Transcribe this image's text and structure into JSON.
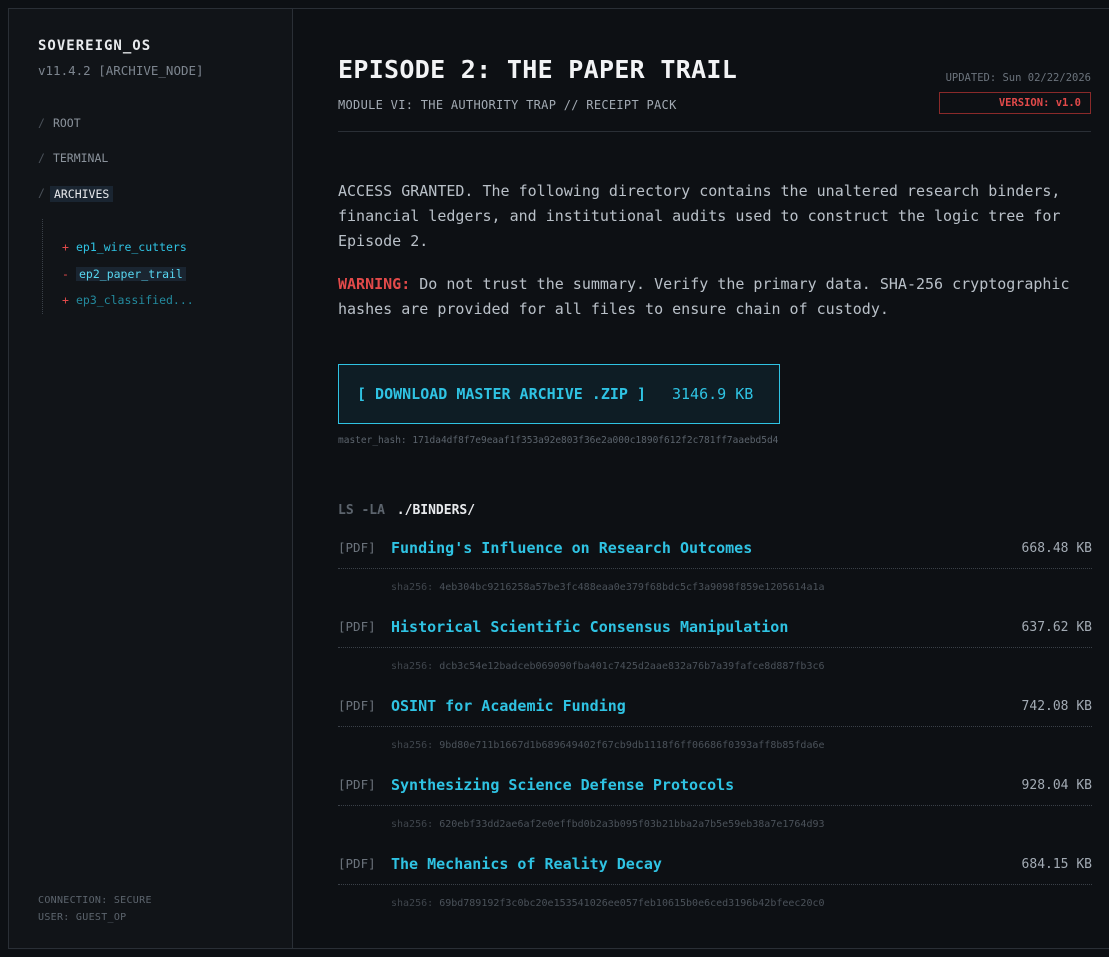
{
  "sidebar": {
    "brand": "SOVEREIGN_OS",
    "version": "v11.4.2 [ARCHIVE_NODE]",
    "nav": [
      {
        "slash": "/",
        "label": "ROOT"
      },
      {
        "slash": "/",
        "label": "TERMINAL"
      },
      {
        "slash": "/",
        "label": "ARCHIVES"
      }
    ],
    "episodes": [
      {
        "mark": "+",
        "label": "ep1_wire_cutters"
      },
      {
        "mark": "-",
        "label": "ep2_paper_trail"
      },
      {
        "mark": "+",
        "label": "ep3_classified..."
      }
    ],
    "status": {
      "connection": "CONNECTION: SECURE",
      "user": "USER: GUEST_OP"
    }
  },
  "header": {
    "title": "EPISODE 2: THE PAPER TRAIL",
    "subtitle": "MODULE VI: THE AUTHORITY TRAP // RECEIPT PACK",
    "updated": "UPDATED: Sun 02/22/2026",
    "version": "VERSION: v1.0"
  },
  "intro": "ACCESS GRANTED. The following directory contains the unaltered research binders, financial ledgers, and institutional audits used to construct the logic tree for Episode 2.",
  "warning": {
    "label": "WARNING:",
    "text": " Do not trust the summary. Verify the primary data. SHA-256 cryptographic hashes are provided for all files to ensure chain of custody."
  },
  "download": {
    "label": "[ DOWNLOAD MASTER ARCHIVE .ZIP ]",
    "size": "3146.9 KB",
    "hash": "master_hash: 171da4df8f7e9eaaf1f353a92e803f36e2a000c1890f612f2c781ff7aaebd5d4"
  },
  "listing": {
    "cmd": "LS -LA",
    "path": "./BINDERS/"
  },
  "files": [
    {
      "tag": "[PDF]",
      "name": "Funding's Influence on Research Outcomes",
      "size": "668.48 KB",
      "hash_key": "sha256:",
      "hash": "4eb304bc9216258a57be3fc488eaa0e379f68bdc5cf3a9098f859e1205614a1a"
    },
    {
      "tag": "[PDF]",
      "name": "Historical Scientific Consensus Manipulation",
      "size": "637.62 KB",
      "hash_key": "sha256:",
      "hash": "dcb3c54e12badceb069090fba401c7425d2aae832a76b7a39fafce8d887fb3c6"
    },
    {
      "tag": "[PDF]",
      "name": "OSINT for Academic Funding",
      "size": "742.08 KB",
      "hash_key": "sha256:",
      "hash": "9bd80e711b1667d1b689649402f67cb9db1118f6ff06686f0393aff8b85fda6e"
    },
    {
      "tag": "[PDF]",
      "name": "Synthesizing Science Defense Protocols",
      "size": "928.04 KB",
      "hash_key": "sha256:",
      "hash": "620ebf33dd2ae6af2e0effbd0b2a3b095f03b21bba2a7b5e59eb38a7e1764d93"
    },
    {
      "tag": "[PDF]",
      "name": "The Mechanics of Reality Decay",
      "size": "684.15 KB",
      "hash_key": "sha256:",
      "hash": "69bd789192f3c0bc20e153541026ee057feb10615b0e6ced3196b42bfeec20c0"
    }
  ]
}
